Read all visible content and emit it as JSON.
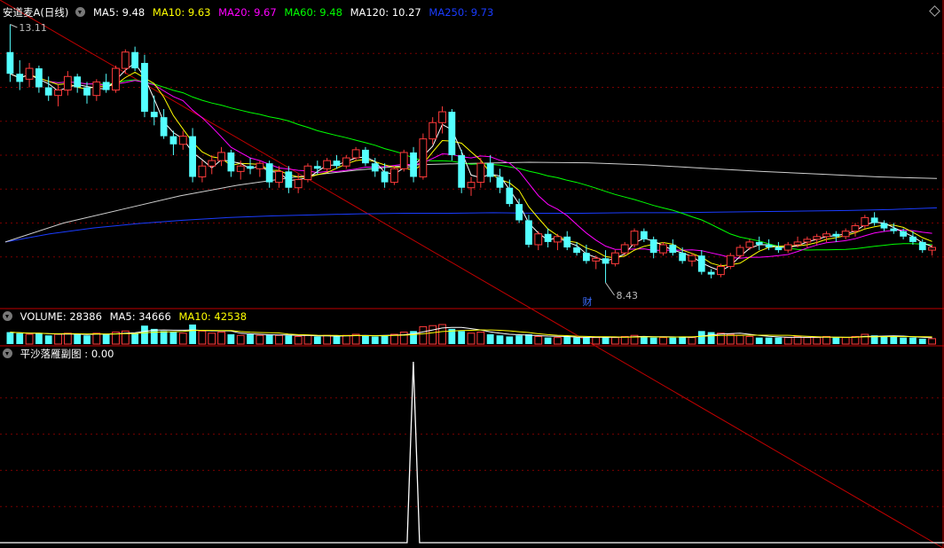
{
  "stock": {
    "title": "安道麦A(日线)"
  },
  "main_indicators": [
    {
      "label": "MA5: 9.48",
      "color": "#ffffff"
    },
    {
      "label": "MA10: 9.63",
      "color": "#ffff00"
    },
    {
      "label": "MA20: 9.67",
      "color": "#ff00ff"
    },
    {
      "label": "MA60: 9.48",
      "color": "#00ff00"
    },
    {
      "label": "MA120: 10.27",
      "color": "#ffffff"
    },
    {
      "label": "MA250: 9.73",
      "color": "#1a3cff"
    }
  ],
  "volume_indicators": [
    {
      "label": "VOLUME: 28386",
      "color": "#ffffff"
    },
    {
      "label": "MA5: 34666",
      "color": "#ffffff"
    },
    {
      "label": "MA10: 42538",
      "color": "#ffff00"
    }
  ],
  "sub_indicator": {
    "label": "平沙落雁副图 : 0.00",
    "color": "#ffffff"
  },
  "annotations": {
    "high": "13.11",
    "low": "8.43",
    "event_marker": "财"
  },
  "colors": {
    "up": "#ff3b3b",
    "down": "#54ffff",
    "divider": "#c00000",
    "grid": "#7a0000"
  },
  "chart_data": {
    "type": "candlestick",
    "price_range": [
      8.2,
      13.2
    ],
    "candles": [
      [
        12.6,
        13.11,
        12.05,
        12.2
      ],
      [
        12.2,
        12.45,
        11.9,
        12.05
      ],
      [
        12.1,
        12.4,
        11.95,
        12.3
      ],
      [
        12.3,
        12.35,
        11.85,
        11.95
      ],
      [
        11.95,
        12.15,
        11.7,
        11.8
      ],
      [
        11.8,
        12.0,
        11.6,
        11.9
      ],
      [
        11.9,
        12.25,
        11.8,
        12.15
      ],
      [
        12.15,
        12.2,
        11.85,
        11.95
      ],
      [
        11.95,
        12.05,
        11.65,
        11.8
      ],
      [
        11.8,
        12.1,
        11.7,
        12.05
      ],
      [
        12.05,
        12.2,
        11.85,
        11.9
      ],
      [
        11.9,
        12.35,
        11.85,
        12.3
      ],
      [
        12.3,
        12.65,
        12.2,
        12.6
      ],
      [
        12.6,
        12.7,
        12.25,
        12.3
      ],
      [
        12.4,
        12.55,
        11.4,
        11.5
      ],
      [
        11.5,
        11.8,
        11.25,
        11.4
      ],
      [
        11.4,
        11.55,
        11.0,
        11.05
      ],
      [
        11.05,
        11.15,
        10.7,
        10.9
      ],
      [
        10.9,
        11.15,
        10.8,
        11.05
      ],
      [
        11.05,
        11.2,
        10.2,
        10.3
      ],
      [
        10.3,
        10.6,
        10.2,
        10.5
      ],
      [
        10.5,
        10.7,
        10.35,
        10.6
      ],
      [
        10.6,
        10.85,
        10.5,
        10.75
      ],
      [
        10.75,
        10.8,
        10.3,
        10.4
      ],
      [
        10.4,
        10.6,
        10.25,
        10.5
      ],
      [
        10.5,
        10.65,
        10.35,
        10.45
      ],
      [
        10.45,
        10.6,
        10.3,
        10.55
      ],
      [
        10.55,
        10.6,
        10.1,
        10.2
      ],
      [
        10.2,
        10.5,
        10.1,
        10.4
      ],
      [
        10.4,
        10.5,
        10.0,
        10.1
      ],
      [
        10.1,
        10.35,
        10.0,
        10.25
      ],
      [
        10.25,
        10.55,
        10.2,
        10.5
      ],
      [
        10.5,
        10.6,
        10.35,
        10.45
      ],
      [
        10.45,
        10.65,
        10.4,
        10.6
      ],
      [
        10.6,
        10.7,
        10.45,
        10.5
      ],
      [
        10.5,
        10.7,
        10.45,
        10.65
      ],
      [
        10.65,
        10.85,
        10.6,
        10.8
      ],
      [
        10.8,
        10.85,
        10.5,
        10.55
      ],
      [
        10.55,
        10.65,
        10.3,
        10.4
      ],
      [
        10.4,
        10.55,
        10.1,
        10.2
      ],
      [
        10.2,
        10.5,
        10.15,
        10.45
      ],
      [
        10.45,
        10.8,
        10.4,
        10.75
      ],
      [
        10.75,
        10.85,
        10.2,
        10.3
      ],
      [
        10.3,
        11.1,
        10.25,
        11.0
      ],
      [
        11.0,
        11.4,
        10.9,
        11.3
      ],
      [
        11.3,
        11.6,
        11.1,
        11.5
      ],
      [
        11.5,
        11.55,
        10.6,
        10.7
      ],
      [
        10.7,
        10.8,
        10.0,
        10.1
      ],
      [
        10.1,
        10.3,
        9.95,
        10.2
      ],
      [
        10.2,
        10.65,
        10.1,
        10.55
      ],
      [
        10.55,
        10.7,
        10.2,
        10.3
      ],
      [
        10.3,
        10.45,
        10.0,
        10.1
      ],
      [
        10.1,
        10.25,
        9.75,
        9.8
      ],
      [
        9.8,
        9.9,
        9.45,
        9.5
      ],
      [
        9.5,
        9.6,
        9.0,
        9.05
      ],
      [
        9.05,
        9.3,
        8.95,
        9.25
      ],
      [
        9.25,
        9.35,
        9.0,
        9.1
      ],
      [
        9.1,
        9.25,
        8.95,
        9.2
      ],
      [
        9.2,
        9.3,
        8.95,
        9.0
      ],
      [
        9.0,
        9.1,
        8.85,
        8.9
      ],
      [
        8.9,
        9.05,
        8.7,
        8.75
      ],
      [
        8.75,
        8.85,
        8.6,
        8.8
      ],
      [
        8.8,
        8.95,
        8.35,
        8.7
      ],
      [
        8.7,
        8.95,
        8.65,
        8.9
      ],
      [
        8.9,
        9.1,
        8.85,
        9.05
      ],
      [
        9.05,
        9.35,
        9.0,
        9.3
      ],
      [
        9.3,
        9.35,
        9.1,
        9.15
      ],
      [
        9.15,
        9.2,
        8.8,
        8.9
      ],
      [
        8.9,
        9.1,
        8.85,
        9.05
      ],
      [
        9.05,
        9.15,
        8.85,
        8.9
      ],
      [
        8.9,
        9.0,
        8.7,
        8.75
      ],
      [
        8.75,
        8.9,
        8.65,
        8.85
      ],
      [
        8.85,
        8.95,
        8.5,
        8.55
      ],
      [
        8.55,
        8.6,
        8.43,
        8.5
      ],
      [
        8.5,
        8.7,
        8.45,
        8.65
      ],
      [
        8.65,
        8.9,
        8.6,
        8.85
      ],
      [
        8.85,
        9.05,
        8.8,
        9.0
      ],
      [
        9.0,
        9.15,
        8.95,
        9.1
      ],
      [
        9.1,
        9.2,
        8.95,
        9.05
      ],
      [
        9.05,
        9.15,
        8.95,
        9.0
      ],
      [
        9.0,
        9.1,
        8.9,
        8.95
      ],
      [
        8.95,
        9.1,
        8.9,
        9.05
      ],
      [
        9.05,
        9.2,
        9.0,
        9.1
      ],
      [
        9.1,
        9.2,
        9.0,
        9.15
      ],
      [
        9.15,
        9.25,
        9.05,
        9.2
      ],
      [
        9.2,
        9.3,
        9.1,
        9.25
      ],
      [
        9.25,
        9.3,
        9.1,
        9.2
      ],
      [
        9.2,
        9.35,
        9.15,
        9.3
      ],
      [
        9.3,
        9.45,
        9.2,
        9.4
      ],
      [
        9.4,
        9.6,
        9.35,
        9.55
      ],
      [
        9.55,
        9.65,
        9.4,
        9.45
      ],
      [
        9.45,
        9.5,
        9.3,
        9.35
      ],
      [
        9.35,
        9.45,
        9.25,
        9.3
      ],
      [
        9.3,
        9.35,
        9.15,
        9.2
      ],
      [
        9.2,
        9.3,
        9.05,
        9.1
      ],
      [
        9.1,
        9.15,
        8.9,
        8.95
      ],
      [
        8.95,
        9.05,
        8.85,
        9.0
      ]
    ],
    "volume": [
      0.55,
      0.5,
      0.45,
      0.5,
      0.4,
      0.45,
      0.5,
      0.45,
      0.4,
      0.5,
      0.45,
      0.55,
      0.6,
      0.5,
      0.85,
      0.7,
      0.6,
      0.55,
      0.5,
      0.9,
      0.6,
      0.5,
      0.55,
      0.45,
      0.4,
      0.45,
      0.4,
      0.45,
      0.4,
      0.4,
      0.35,
      0.4,
      0.35,
      0.4,
      0.35,
      0.4,
      0.45,
      0.4,
      0.35,
      0.4,
      0.45,
      0.55,
      0.6,
      0.8,
      0.85,
      0.9,
      0.7,
      0.6,
      0.5,
      0.55,
      0.45,
      0.4,
      0.35,
      0.4,
      0.45,
      0.35,
      0.3,
      0.3,
      0.35,
      0.3,
      0.3,
      0.3,
      0.35,
      0.3,
      0.35,
      0.4,
      0.35,
      0.3,
      0.3,
      0.3,
      0.35,
      0.3,
      0.6,
      0.55,
      0.5,
      0.45,
      0.4,
      0.35,
      0.3,
      0.3,
      0.3,
      0.3,
      0.35,
      0.3,
      0.3,
      0.35,
      0.3,
      0.3,
      0.35,
      0.45,
      0.4,
      0.35,
      0.35,
      0.3,
      0.3,
      0.25,
      0.25
    ],
    "ma250": [
      9.1,
      9.25,
      9.36,
      9.44,
      9.5,
      9.55,
      9.58,
      9.6,
      9.62,
      9.63,
      9.63,
      9.64,
      9.63,
      9.63,
      9.64,
      9.64,
      9.65,
      9.66,
      9.67,
      9.68,
      9.7,
      9.73
    ],
    "ma120": [
      9.1,
      9.45,
      9.7,
      9.95,
      10.15,
      10.3,
      10.42,
      10.52,
      10.55,
      10.57,
      10.56,
      10.52,
      10.46,
      10.4,
      10.35,
      10.3,
      10.27
    ],
    "signal": {
      "spike_index": 43,
      "peak_value": 1.0
    }
  }
}
